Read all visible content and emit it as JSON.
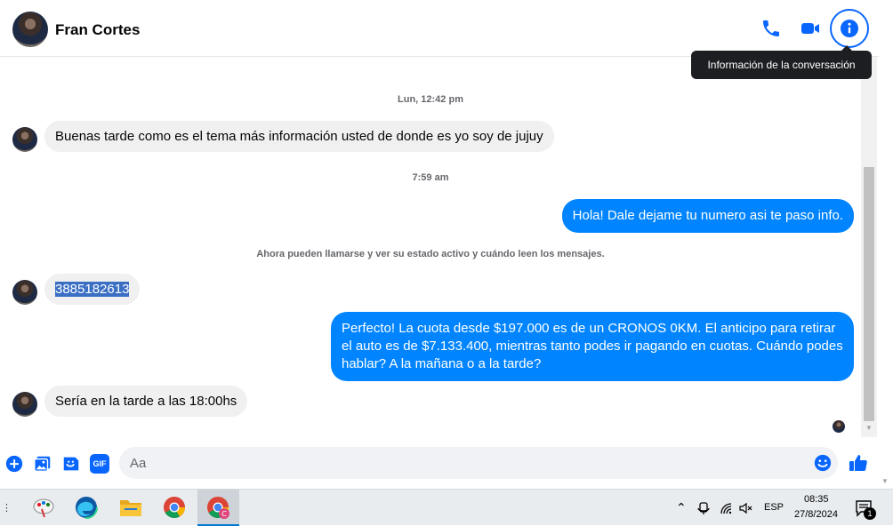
{
  "header": {
    "contact_name": "Fran Cortes",
    "tooltip": "Información de la conversación"
  },
  "messages": {
    "ts1": "Lun, 12:42 pm",
    "msg1": "Buenas tarde como es el tema más información usted de donde es yo soy de jujuy",
    "ts2": "7:59 am",
    "msg2": "Hola! Dale dejame tu numero  asi te paso info.",
    "notice": "Ahora pueden llamarse y ver su estado activo y cuándo leen los mensajes.",
    "msg3": "3885182613",
    "msg4": "Perfecto! La cuota desde $197.000 es de un CRONOS 0KM. El anticipo para retirar el auto es de $7.133.400, mientras tanto podes ir pagando en cuotas. Cuándo podes hablar? A la mañana o a la tarde?",
    "msg5": "Sería en la tarde a las 18:00hs"
  },
  "composer": {
    "placeholder": "Aa",
    "gif_label": "GIF"
  },
  "taskbar": {
    "language": "ESP",
    "time": "08:35",
    "date": "27/8/2024",
    "notification_count": "1"
  },
  "colors": {
    "accent": "#0866ff",
    "outgoing_bubble": "#0084ff",
    "incoming_bubble": "#f0f0f0"
  }
}
